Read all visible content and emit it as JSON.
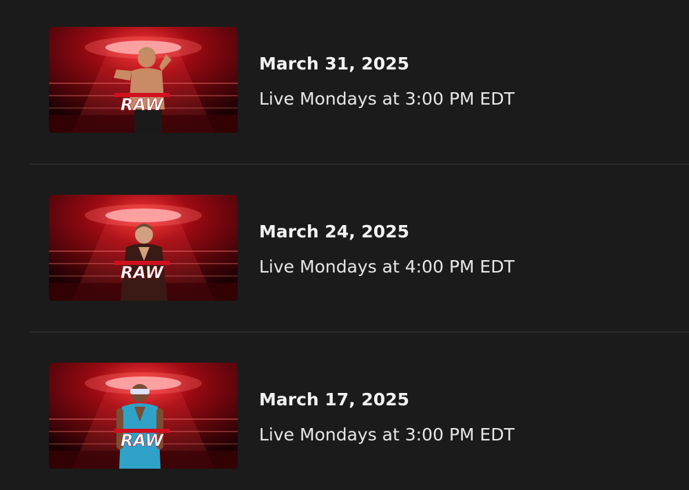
{
  "episodes": [
    {
      "date": "March 31, 2025",
      "schedule": "Live Mondays at 3:00 PM EDT",
      "logo_text": "RAW",
      "wrestler_colors": {
        "skin": "#c98a66",
        "top": "#c98a66",
        "bottom": "#1a1a1a"
      }
    },
    {
      "date": "March 24, 2025",
      "schedule": "Live Mondays at 4:00 PM EDT",
      "logo_text": "RAW",
      "wrestler_colors": {
        "skin": "#d0a080",
        "top": "#3a1a14",
        "bottom": "#2a1210"
      }
    },
    {
      "date": "March 17, 2025",
      "schedule": "Live Mondays at 3:00 PM EDT",
      "logo_text": "RAW",
      "wrestler_colors": {
        "skin": "#7a4e34",
        "top": "#2fa2c8",
        "bottom": "#2fa2c8"
      }
    }
  ],
  "colors": {
    "background": "#1b1b1b",
    "divider": "#3c3c3c",
    "title": "#f2f2f2",
    "subtitle": "#e8e8e8",
    "raw_red": "#d0101e"
  }
}
